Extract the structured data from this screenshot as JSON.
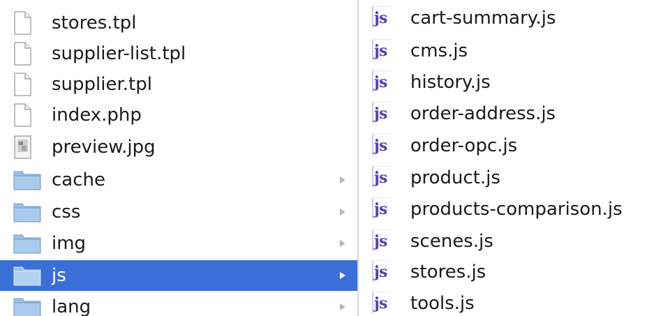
{
  "left_column": {
    "items": [
      {
        "name": "stores.tpl",
        "type": "file"
      },
      {
        "name": "supplier-list.tpl",
        "type": "file"
      },
      {
        "name": "supplier.tpl",
        "type": "file"
      },
      {
        "name": "index.php",
        "type": "file"
      },
      {
        "name": "preview.jpg",
        "type": "image"
      },
      {
        "name": "cache",
        "type": "folder"
      },
      {
        "name": "css",
        "type": "folder"
      },
      {
        "name": "img",
        "type": "folder"
      },
      {
        "name": "js",
        "type": "folder",
        "selected": true
      },
      {
        "name": "lang",
        "type": "folder"
      }
    ]
  },
  "right_column": {
    "items": [
      {
        "name": "cart-summary.js"
      },
      {
        "name": "cms.js"
      },
      {
        "name": "history.js"
      },
      {
        "name": "order-address.js"
      },
      {
        "name": "order-opc.js"
      },
      {
        "name": "product.js"
      },
      {
        "name": "products-comparison.js"
      },
      {
        "name": "scenes.js"
      },
      {
        "name": "stores.js"
      },
      {
        "name": "tools.js"
      }
    ],
    "icon_text": "js"
  },
  "colors": {
    "selection": "#3b6fd8",
    "folder": "#8fb7dd",
    "js_icon": "#5b3fa8"
  }
}
